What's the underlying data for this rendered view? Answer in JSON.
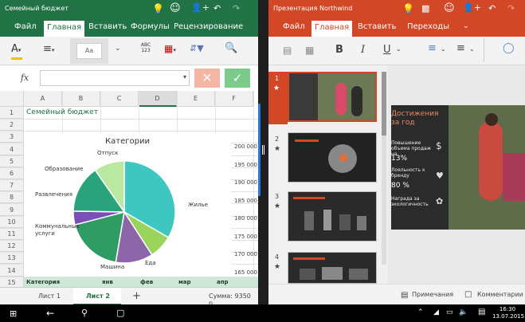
{
  "excel": {
    "title": "Семейный бюджет",
    "tabs": [
      "Файл",
      "Главная",
      "Вставить",
      "Формулы",
      "Рецензирование"
    ],
    "active_tab": "Главная",
    "ribbon": {
      "font_sample": "Aa",
      "number_format_label": "ABC\n123"
    },
    "formula_bar": {
      "fx": "fx",
      "value": ""
    },
    "columns": [
      "A",
      "B",
      "C",
      "D",
      "E",
      "F"
    ],
    "rows": [
      "1",
      "2",
      "3",
      "4",
      "5",
      "6",
      "7",
      "8",
      "9",
      "10",
      "11",
      "12",
      "13",
      "14",
      "15"
    ],
    "cell_a1": "Семейный бюджет",
    "row15": [
      "Категория",
      "янв",
      "фев",
      "мар",
      "апр"
    ],
    "sheets": [
      "Лист 1",
      "Лист 2"
    ],
    "active_sheet": "Лист 2",
    "add_sheet": "+",
    "status": "Сумма: 9350 р.",
    "colors": {
      "brand": "#217346"
    },
    "right_axis": [
      "200 000",
      "195 000",
      "190 000",
      "185 000",
      "180 000",
      "175 000",
      "170 000",
      "165 000"
    ]
  },
  "chart_data": {
    "type": "pie",
    "title": "Категории",
    "categories": [
      "Жилье",
      "Еда",
      "Машина",
      "Коммунальные услуги",
      "Развлечения",
      "Образование",
      "Отпуск"
    ],
    "values": [
      31,
      7,
      11,
      17,
      4,
      14,
      9
    ],
    "colors": [
      "#3ec7c0",
      "#9bd45b",
      "#8c66a8",
      "#2f9c63",
      "#7a4fb8",
      "#2aa37c",
      "#b9e8a0"
    ]
  },
  "powerpoint": {
    "title": "Презентация Northwind",
    "tabs": [
      "Файл",
      "Главная",
      "Вставить",
      "Переходы"
    ],
    "active_tab": "Главная",
    "ribbon": {
      "bold": "B",
      "italic": "I",
      "underline": "U"
    },
    "slides": [
      "1",
      "2",
      "3",
      "4"
    ],
    "current_slide": {
      "heading": "Достижения за год",
      "items": [
        "Повышение объема продаж на",
        "13%",
        "Лояльность к бренду",
        "80 %",
        "Награда за экологичность"
      ]
    },
    "status": {
      "notes": "Примечания",
      "comments": "Комментарии"
    },
    "colors": {
      "brand": "#d24726"
    }
  },
  "taskbar": {
    "time": "16:30",
    "date": "13.07.2015"
  }
}
